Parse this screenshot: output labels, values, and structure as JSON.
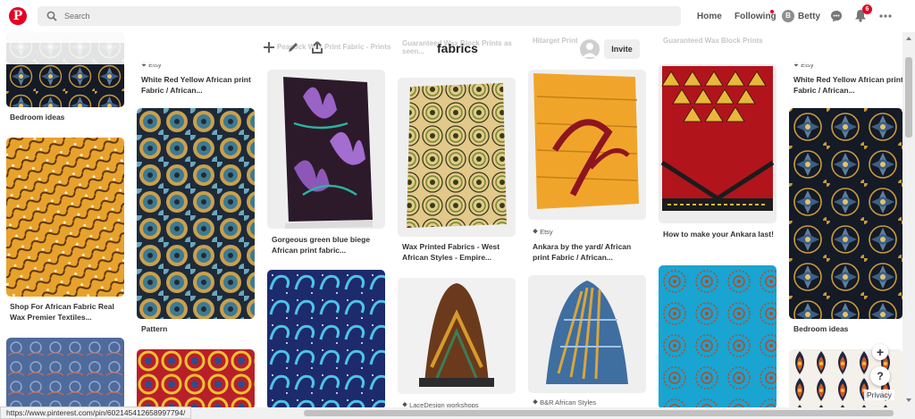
{
  "header": {
    "logo": "P",
    "search_placeholder": "Search",
    "home_label": "Home",
    "following_label": "Following",
    "user_initial": "B",
    "user_name": "Betty",
    "notifications_count": "6"
  },
  "board": {
    "title": "fabrics",
    "invite_label": "Invite",
    "ghost_titles": [
      "Peacock Wax Print Fabric - Prints",
      "Guaranteed Wax Block Prints as seen...",
      "Hitarget Print",
      "Guaranteed Wax Block Prints"
    ]
  },
  "pins": {
    "c1_p1_title": "Bedroom ideas",
    "c1_p2_title": "Shop For African Fabric Real Wax Premier Textiles...",
    "c2_p1_source": "Etsy",
    "c2_p1_title": "White Red Yellow African print Fabric / African...",
    "c2_p2_title": "Pattern",
    "c3_p1_title": "Gorgeous green blue biege African print fabric...",
    "c4_p1_title": "Wax Printed Fabrics - West African Styles - Empire...",
    "c4_p2_source": "LaceDesign workshops",
    "c5_p1_source": "Etsy",
    "c5_p1_title": "Ankara by the yard/ African print Fabric / African...",
    "c5_p2_source": "B&R African Styles",
    "c6_p1_title": "How to make your Ankara last!",
    "c7_p1_source": "Etsy",
    "c7_p1_title": "White Red Yellow African print Fabric / African...",
    "c7_p2_title": "Bedroom ideas"
  },
  "floating": {
    "plus_label": "+",
    "help_label": "?",
    "privacy_label": "Privacy"
  },
  "status_url": "https://www.pinterest.com/pin/602145412658997794/",
  "colors": {
    "brand": "#e60023",
    "search_bg": "#efefef"
  }
}
